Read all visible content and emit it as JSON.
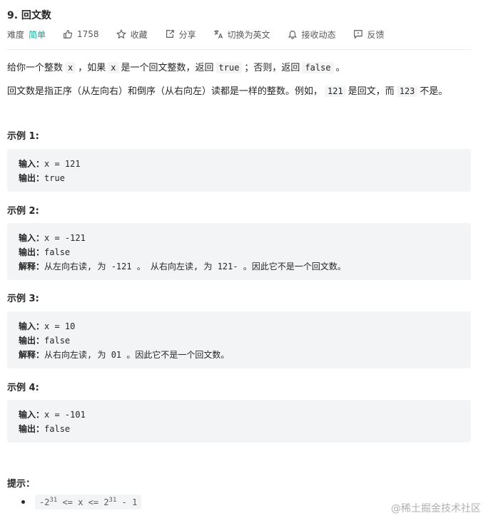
{
  "problem": {
    "title": "9. 回文数",
    "difficulty_label": "难度",
    "difficulty_value": "简单",
    "likes": "1758",
    "favorite": "收藏",
    "share": "分享",
    "switch_lang": "切换为英文",
    "notifications": "接收动态",
    "feedback": "反馈"
  },
  "description": {
    "line1": {
      "t1": "给你一个整数",
      "c1": "x",
      "t2": "，如果",
      "c2": "x",
      "t3": "是一个回文整数，返回",
      "c3": "true",
      "t4": "；否则，返回",
      "c4": "false",
      "t5": "。"
    },
    "line2": {
      "t1": "回文数是指正序（从左向右）和倒序（从右向左）读都是一样的整数。例如，",
      "c1": "121",
      "t2": "是回文，而",
      "c2": "123",
      "t3": "不是。"
    }
  },
  "examples": [
    {
      "title": "示例 1:",
      "input_label": "输入：",
      "input": "x = 121",
      "output_label": "输出：",
      "output": "true"
    },
    {
      "title": "示例 2:",
      "input_label": "输入：",
      "input": "x = -121",
      "output_label": "输出：",
      "output": "false",
      "explain_label": "解释：",
      "explain": "从左向右读, 为 -121 。 从右向左读, 为 121- 。因此它不是一个回文数。"
    },
    {
      "title": "示例 3:",
      "input_label": "输入：",
      "input": "x = 10",
      "output_label": "输出：",
      "output": "false",
      "explain_label": "解释：",
      "explain": "从右向左读, 为 01 。因此它不是一个回文数。"
    },
    {
      "title": "示例 4:",
      "input_label": "输入：",
      "input": "x = -101",
      "output_label": "输出：",
      "output": "false"
    }
  ],
  "hints": {
    "title": "提示：",
    "constraint": {
      "part1": "-2",
      "exp1": "31",
      "part2": " <= x <= 2",
      "exp2": "31",
      "part3": " - 1"
    }
  },
  "watermark": "@稀土掘金技术社区",
  "colors": {
    "difficulty_easy": "#00af9b",
    "code_background": "#f3f4f5"
  }
}
